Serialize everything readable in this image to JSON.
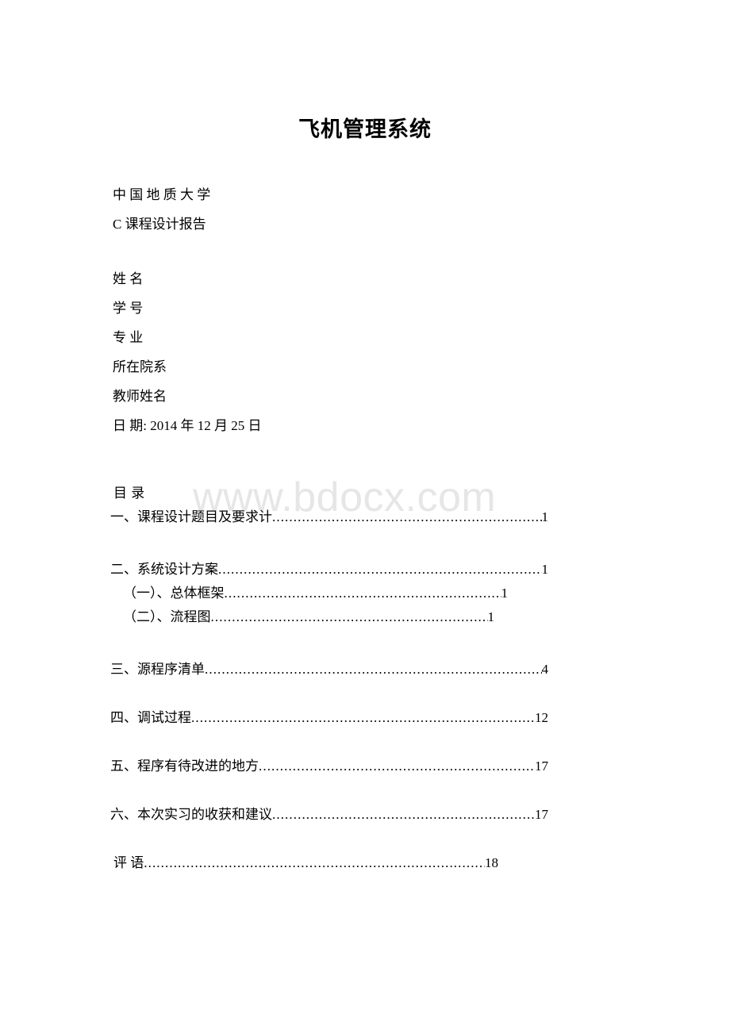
{
  "document": {
    "title": "飞机管理系统",
    "watermark": "www.bdocx.com"
  },
  "cover": {
    "university": "中 国 地 质 大 学",
    "report_type": "C 课程设计报告",
    "fields": [
      {
        "label": "姓 名"
      },
      {
        "label": "学 号"
      },
      {
        "label": "专 业"
      },
      {
        "label": "所在院系"
      },
      {
        "label": "教师姓名"
      },
      {
        "label": "日 期: 2014 年 12 月 25 日"
      }
    ]
  },
  "toc": {
    "heading": "目 录",
    "entries": [
      {
        "label": "一、课程设计题目及要求计",
        "page": "1",
        "level": 1
      },
      {
        "label": "二、系统设计方案",
        "page": "1",
        "level": 1
      },
      {
        "label": "（一）、总体框架",
        "page": "1",
        "level": 2
      },
      {
        "label": "（二）、流程图",
        "page": "1",
        "level": 2
      },
      {
        "label": "三、源程序清单",
        "page": "4",
        "level": 1
      },
      {
        "label": "四、调试过程",
        "page": "12",
        "level": 1
      },
      {
        "label": "五、程序有待改进的地方",
        "page": "17",
        "level": 1
      },
      {
        "label": "六、本次实习的收获和建议",
        "page": "17",
        "level": 1
      },
      {
        "label": "评 语",
        "page": "18",
        "level": 0
      }
    ]
  }
}
